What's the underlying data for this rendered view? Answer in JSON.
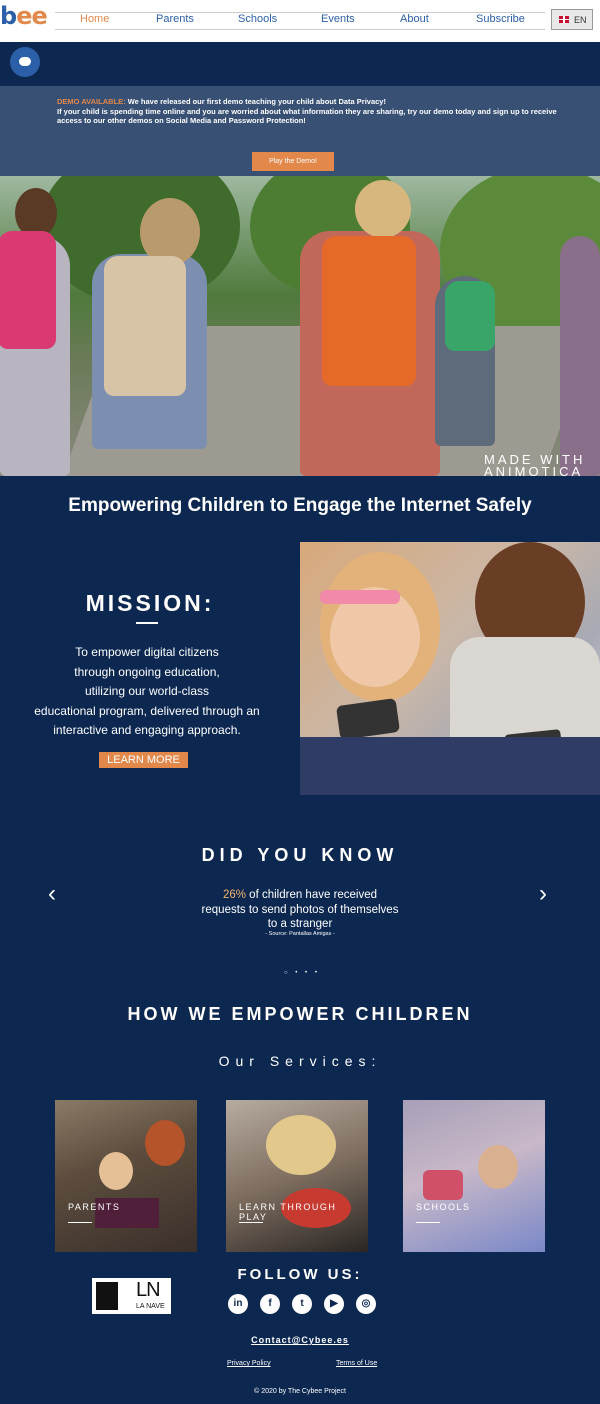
{
  "header": {
    "logo": {
      "part1": "b",
      "part2": "ee"
    },
    "nav": [
      "Home",
      "Parents",
      "Schools",
      "Events",
      "About",
      "Subscribe"
    ],
    "active_nav": "Home",
    "language": "EN"
  },
  "demo_banner": {
    "label": "DEMO AVAILABLE:",
    "line1": "We have released our first demo teaching your child about Data Privacy!",
    "line2": "If your child is spending time online and you are worried about what information they are sharing, try our demo today and sign up to receive access to our other demos on Social Media and Password Protection!",
    "button": "Play the Demo!"
  },
  "hero": {
    "watermark_line1": "MADE WITH",
    "watermark_line2": "ANIMOTICA"
  },
  "headline": "Empowering Children to Engage the Internet Safely",
  "mission": {
    "title": "MISSION:",
    "text_lines": [
      "To empower digital citizens",
      "through ongoing education,",
      "utilizing our world-class",
      "educational program, delivered through an",
      "interactive and engaging approach."
    ],
    "button": "LEARN MORE"
  },
  "did_you_know": {
    "title": "DID YOU KNOW",
    "percent": "26%",
    "fact_rest": " of children have received requests to send photos of themselves to a stranger",
    "source": "- Source: Pantallas Amigas -",
    "prev_arrow": "‹",
    "next_arrow": "›",
    "dots": "○ • • •"
  },
  "how_we_empower": {
    "title": "HOW WE EMPOWER CHILDREN",
    "subtitle": "Our Services:",
    "services": [
      {
        "label": "PARENTS"
      },
      {
        "label": "LEARN THROUGH PLAY"
      },
      {
        "label": "SCHOOLS"
      }
    ]
  },
  "footer": {
    "partner_logo_text": "LA NAVE",
    "follow_title": "FOLLOW US:",
    "social": [
      "in",
      "f",
      "t",
      "▶",
      "◎"
    ],
    "contact": "Contact@Cybee.es",
    "privacy": "Privacy Policy",
    "terms": "Terms of Use",
    "copyright": "© 2020 by The Cybee Project"
  },
  "colors": {
    "navy": "#0c2750",
    "accent_orange": "#e2884a",
    "link_blue": "#2b5fa8",
    "banner_blue": "#375074"
  }
}
